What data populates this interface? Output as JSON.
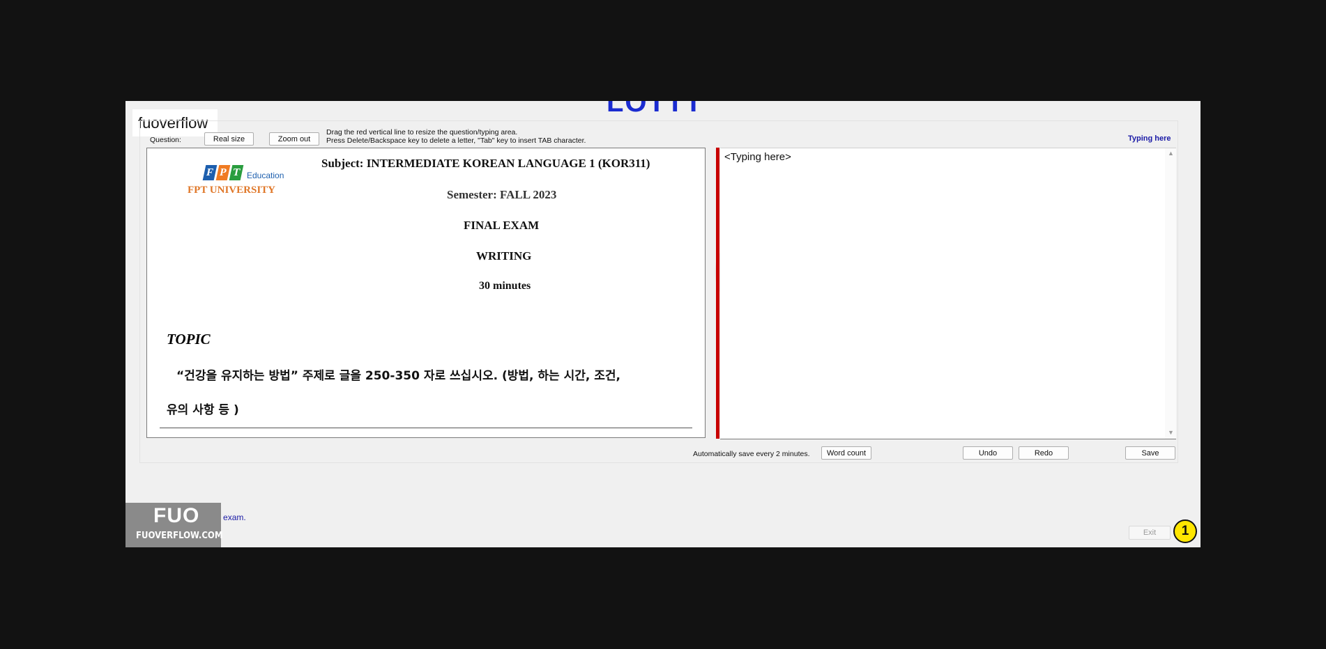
{
  "header": {
    "cropped_title": "LOTTT",
    "brand_label": "fuoverflow"
  },
  "toolbar": {
    "question_label": "Question:",
    "real_size": "Real size",
    "zoom_out": "Zoom out",
    "hint_line1": "Drag the red vertical line to resize the question/typing area.",
    "hint_line2": "Press Delete/Backspace key to delete a letter, \"Tab\" key to insert TAB character.",
    "typing_here_label": "Typing here"
  },
  "question": {
    "logo_letters": [
      "F",
      "P",
      "T"
    ],
    "logo_colors": [
      "#1d5fae",
      "#f07b22",
      "#2a9d3f"
    ],
    "logo_education": "Education",
    "logo_university": "FPT UNIVERSITY",
    "subject": "Subject: INTERMEDIATE KOREAN LANGUAGE 1 (KOR311)",
    "semester": "Semester: FALL 2023",
    "exam": "FINAL EXAM",
    "section": "WRITING",
    "duration": "30 minutes",
    "topic_heading": "TOPIC",
    "prompt_line1": "“건강을 유지하는 방법” 주제로 글을 250-350 자로 쓰십시오. (방법, 하는 시간, 조건,",
    "prompt_line2": "유의 사항 등 )"
  },
  "answer": {
    "placeholder": "<Typing here>"
  },
  "bottom_bar": {
    "autosave_note": "Automatically save every 2 minutes.",
    "word_count": "Word count",
    "undo": "Undo",
    "redo": "Redo",
    "save": "Save"
  },
  "footer": {
    "finish_checkbox_label": "I want to finish the exam.",
    "exit": "Exit",
    "step_badge": "1"
  },
  "watermark": {
    "logo_text": "FUO",
    "site": "FUOVERFLOW.COM"
  }
}
